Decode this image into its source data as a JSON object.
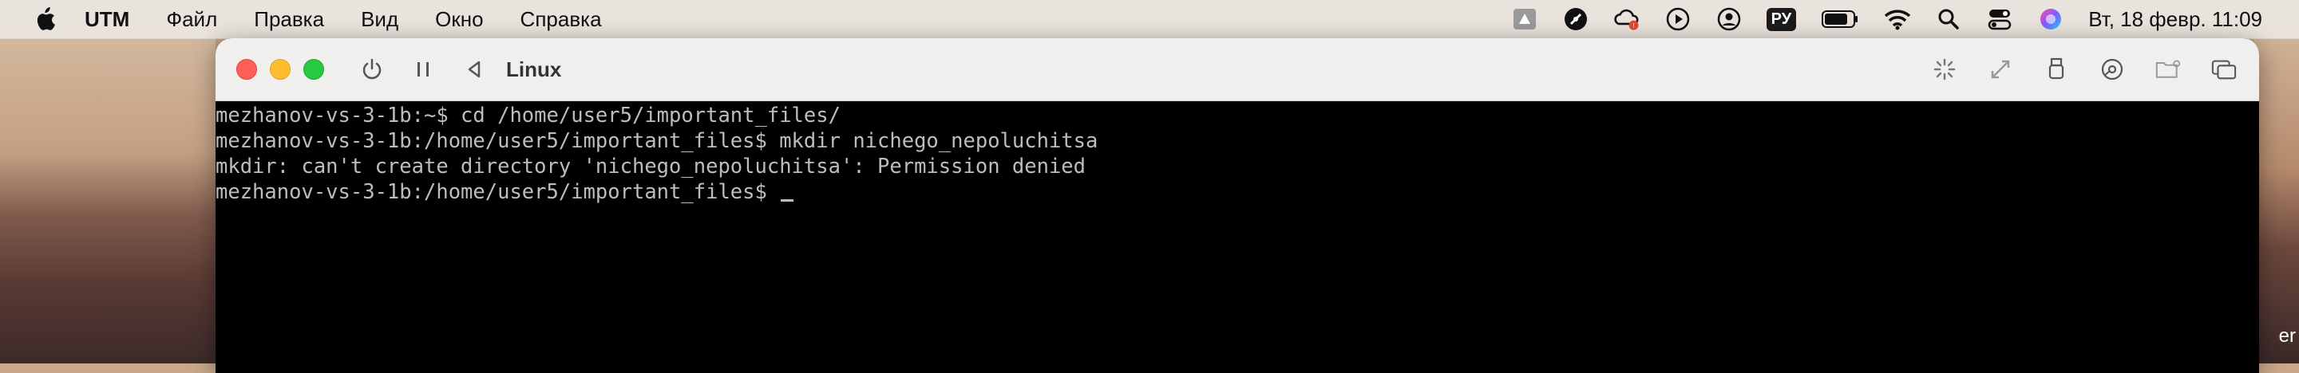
{
  "menubar": {
    "app_name": "UTM",
    "menus": [
      "Файл",
      "Правка",
      "Вид",
      "Окно",
      "Справка"
    ],
    "status": {
      "input_language": "РУ",
      "clock": "Вт, 18 февр.  11:09",
      "icons": [
        "drive-icon",
        "speed-icon",
        "creative-cloud-icon",
        "play-icon",
        "user-account-icon",
        "battery-icon",
        "wifi-icon",
        "spotlight-search-icon",
        "control-center-icon",
        "siri-icon"
      ]
    }
  },
  "window": {
    "title": "Linux",
    "toolbar_icons": [
      "power-icon",
      "pause-icon",
      "back-icon",
      "capture-input-icon",
      "resize-icon",
      "usb-icon",
      "drives-icon",
      "shared-folder-icon",
      "windows-icon"
    ]
  },
  "terminal": {
    "lines": [
      "mezhanov-vs-3-1b:~$ cd /home/user5/important_files/",
      "mezhanov-vs-3-1b:/home/user5/important_files$ mkdir nichego_nepoluchitsa",
      "mkdir: can't create directory 'nichego_nepoluchitsa': Permission denied",
      "mezhanov-vs-3-1b:/home/user5/important_files$ "
    ]
  },
  "desktop": {
    "right_edge_text": "er"
  }
}
